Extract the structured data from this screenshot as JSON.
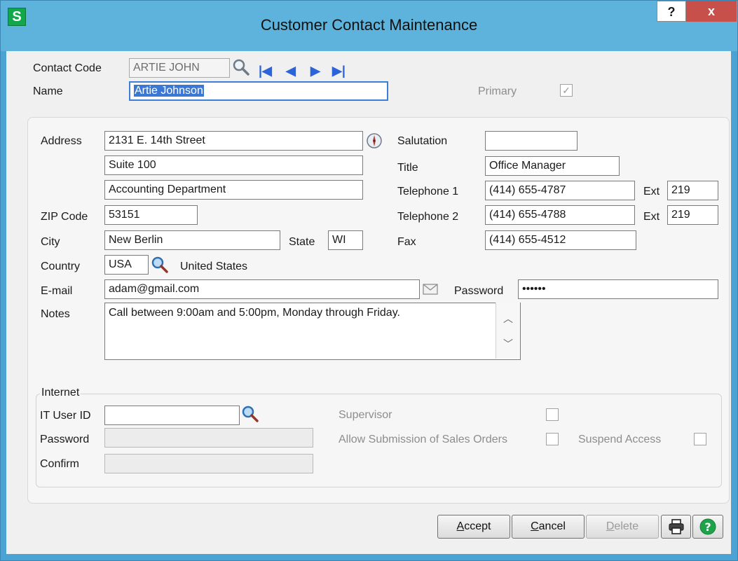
{
  "window": {
    "title": "Customer Contact Maintenance",
    "help": "?",
    "close": "x",
    "app_letter": "S"
  },
  "header": {
    "contact_code_label": "Contact Code",
    "contact_code_value": "ARTIE JOHN",
    "name_label": "Name",
    "name_value": "Artie Johnson",
    "primary_label": "Primary",
    "primary_checked": "✓"
  },
  "address": {
    "address_label": "Address",
    "line1": "2131 E. 14th Street",
    "line2": "Suite 100",
    "line3": "Accounting Department",
    "zip_label": "ZIP Code",
    "zip_value": "53151",
    "city_label": "City",
    "city_value": "New Berlin",
    "state_label": "State",
    "state_value": "WI",
    "country_label": "Country",
    "country_code": "USA",
    "country_name": "United States",
    "email_label": "E-mail",
    "email_value": "adam@gmail.com",
    "notes_label": "Notes",
    "notes_value": "Call between 9:00am and 5:00pm, Monday through Friday."
  },
  "contact": {
    "salutation_label": "Salutation",
    "salutation_value": "",
    "title_label": "Title",
    "title_value": "Office Manager",
    "tel1_label": "Telephone 1",
    "tel1_value": "(414) 655-4787",
    "tel1_ext_label": "Ext",
    "tel1_ext_value": "219",
    "tel2_label": "Telephone 2",
    "tel2_value": "(414) 655-4788",
    "tel2_ext_label": "Ext",
    "tel2_ext_value": "219",
    "fax_label": "Fax",
    "fax_value": "(414) 655-4512",
    "password_label": "Password",
    "password_value": "••••••"
  },
  "internet": {
    "group_label": "Internet",
    "user_id_label": "IT User ID",
    "user_id_value": "",
    "password_label": "Password",
    "confirm_label": "Confirm",
    "supervisor_label": "Supervisor",
    "allow_orders_label": "Allow Submission of Sales Orders",
    "suspend_label": "Suspend Access"
  },
  "buttons": {
    "accept": "ccept",
    "accept_key": "A",
    "cancel": "ancel",
    "cancel_key": "C",
    "delete": "elete",
    "delete_key": "D"
  },
  "icons": {
    "lookup": "magnifier-icon",
    "first": "first-record-icon",
    "prev": "previous-record-icon",
    "next": "next-record-icon",
    "last": "last-record-icon",
    "compass": "compass-icon",
    "mail": "envelope-icon",
    "print": "printer-icon",
    "help": "help-icon"
  }
}
